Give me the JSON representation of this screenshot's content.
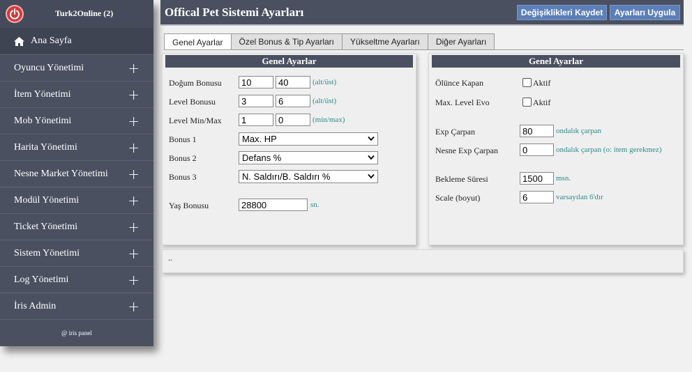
{
  "sidebar": {
    "title": "Turk2Online (2)",
    "home": "Ana Sayfa",
    "items": [
      {
        "label": "Oyuncu Yönetimi"
      },
      {
        "label": "İtem Yönetimi"
      },
      {
        "label": "Mob Yönetimi"
      },
      {
        "label": "Harita Yönetimi"
      },
      {
        "label": "Nesne Market Yönetimi"
      },
      {
        "label": "Modül Yönetimi"
      },
      {
        "label": "Ticket Yönetimi"
      },
      {
        "label": "Sistem Yönetimi"
      },
      {
        "label": "Log Yönetimi"
      },
      {
        "label": "İris Admin"
      }
    ],
    "plus": "+",
    "footer": "@ iris panel"
  },
  "header": {
    "title": "Offical Pet Sistemi Ayarları",
    "save_button": "Değişiklikleri Kaydet",
    "apply_button": "Ayarları Uygula"
  },
  "tabs": [
    {
      "label": "Genel Ayarlar",
      "active": true
    },
    {
      "label": "Özel Bonus & Tip Ayarları",
      "active": false
    },
    {
      "label": "Yükseltme Ayarları",
      "active": false
    },
    {
      "label": "Diğer Ayarları",
      "active": false
    }
  ],
  "left_panel": {
    "title": "Genel Ayarlar",
    "dogum": {
      "label": "Doğum Bonusu",
      "v1": "10",
      "v2": "40",
      "hint": "(alt/üst)"
    },
    "level_bonus": {
      "label": "Level Bonusu",
      "v1": "3",
      "v2": "6",
      "hint": "(alt/üst)"
    },
    "level_minmax": {
      "label": "Level Min/Max",
      "v1": "1",
      "v2": "0",
      "hint": "(min/max)"
    },
    "bonus1": {
      "label": "Bonus 1",
      "value": "Max. HP"
    },
    "bonus2": {
      "label": "Bonus 2",
      "value": "Defans %"
    },
    "bonus3": {
      "label": "Bonus 3",
      "value": "N. Saldırı/B. Saldırı %"
    },
    "yas": {
      "label": "Yaş Bonusu",
      "value": "28800",
      "unit": "sn."
    }
  },
  "right_panel": {
    "title": "Genel Ayarlar",
    "olunce": {
      "label": "Ölünce Kapan",
      "check_label": "Aktif",
      "checked": false
    },
    "maxlevel": {
      "label": "Max. Level Evo",
      "check_label": "Aktif",
      "checked": false
    },
    "exp": {
      "label": "Exp Çarpan",
      "value": "80",
      "hint": "ondalık çarpan"
    },
    "nesne_exp": {
      "label": "Nesne Exp Çarpan",
      "value": "0",
      "hint": "ondalık çarpan (o: item gerekmez)"
    },
    "bekleme": {
      "label": "Bekleme Süresi",
      "value": "1500",
      "unit": "msn."
    },
    "scale": {
      "label": "Scale (boyut)",
      "value": "6",
      "hint": "varsayılan 6'dır"
    }
  },
  "footer_text": "..",
  "colors": {
    "sidebar": "#4a5060",
    "accent_button": "#5c7fb8",
    "hint": "#2a8a8a",
    "power": "#d23a3a"
  }
}
